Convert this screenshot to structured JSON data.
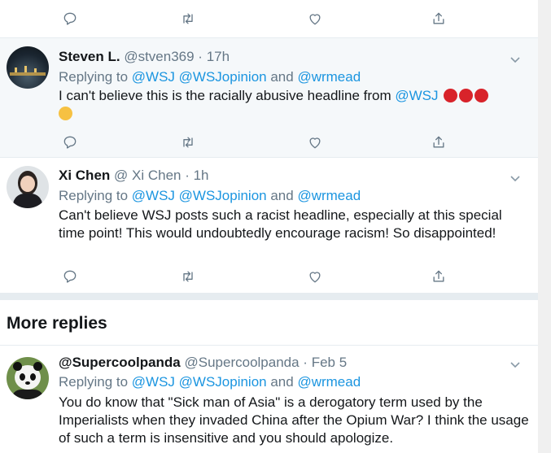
{
  "actions_icons": [
    "reply-icon",
    "retweet-icon",
    "like-icon",
    "share-icon"
  ],
  "tweets": [
    {
      "name": "Steven L.",
      "handle": "@stven369 · 17h",
      "replying_prefix": "Replying to ",
      "replying_targets": "@WSJ @WSJopinion",
      "replying_and": " and ",
      "replying_last": "@wrmead",
      "text_before": "I can't believe this is the racially abusive headline from ",
      "text_mention": "@WSJ",
      "emojis": [
        "angry-face",
        "angry-face",
        "angry-face",
        "cursing-face"
      ]
    },
    {
      "name": "Xi Chen",
      "handle": "@ Xi Chen  · 1h",
      "replying_prefix": "Replying to ",
      "replying_targets": "@WSJ @WSJopinion",
      "replying_and": " and ",
      "replying_last": "@wrmead",
      "text": "Can't believe WSJ posts such a racist headline, especially at this special time point! This would undoubtedly encourage racism! So disappointed!"
    },
    {
      "name": "@Supercoolpanda",
      "handle": "@Supercoolpanda · Feb 5",
      "replying_prefix": "Replying to ",
      "replying_targets": "@WSJ @WSJopinion",
      "replying_and": " and ",
      "replying_last": "@wrmead",
      "text": "You do know that \"Sick man of Asia\" is a derogatory term used by the Imperialists when they invaded China after the Opium War? I think the usage of such a term is insensitive and you should apologize."
    }
  ],
  "section_title": "More replies",
  "colors": {
    "link": "#1b95e0",
    "muted": "#657786",
    "shaded_bg": "#f5f8fa",
    "separator": "#e6ecf0"
  }
}
